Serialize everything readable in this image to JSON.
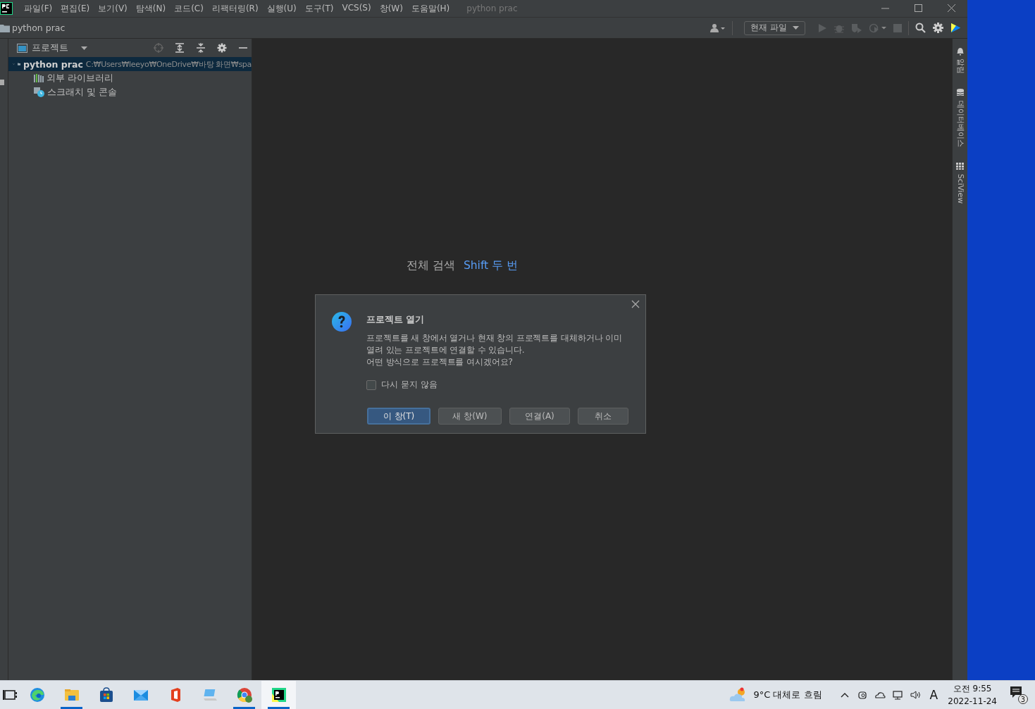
{
  "menu_bar": {
    "items": [
      "파일(F)",
      "편집(E)",
      "보기(V)",
      "탐색(N)",
      "코드(C)",
      "리팩터링(R)",
      "실행(U)",
      "도구(T)",
      "VCS(S)",
      "창(W)",
      "도움말(H)"
    ],
    "title": "python prac"
  },
  "nav_bar": {
    "breadcrumb": "python prac",
    "run_config": "현재 파일"
  },
  "project_panel": {
    "title": "프로젝트",
    "tree": [
      {
        "label": "python prac",
        "path": "C:₩Users₩leeyo₩OneDrive₩바탕 화면₩spa",
        "kind": "folder",
        "expanded": true,
        "selected": true,
        "children": [
          {
            "label": "외부 라이브러리",
            "kind": "library",
            "selected": false
          },
          {
            "label": "스크래치 및 콘솔",
            "kind": "scratch",
            "selected": false
          }
        ]
      }
    ]
  },
  "editor": {
    "hints": [
      {
        "action": "전체 검색",
        "shortcut": "Shift 두 번"
      }
    ]
  },
  "right_tool_windows": [
    {
      "label": "알림",
      "kind": "bell"
    },
    {
      "label": "데이터베이스",
      "kind": "database"
    },
    {
      "label": "SciView",
      "kind": "grid"
    }
  ],
  "dialog": {
    "title": "프로젝트 열기",
    "message_lines": [
      "프로젝트를 새 창에서 열거나 현재 창의 프로젝트를 대체하거나 이미",
      "열려 있는 프로젝트에 연결할 수 있습니다.",
      "어떤 방식으로 프로젝트를 여시겠어요?"
    ],
    "checkbox": {
      "label": "다시 묻지 않음",
      "checked": false
    },
    "buttons": [
      {
        "label": "이 창(T)",
        "default": true
      },
      {
        "label": "새 창(W)",
        "default": false
      },
      {
        "label": "연결(A)",
        "default": false
      },
      {
        "label": "취소",
        "default": false
      }
    ]
  },
  "taskbar": {
    "apps": [
      {
        "kind": "taskview",
        "running": false,
        "active": false
      },
      {
        "kind": "edge",
        "running": false,
        "active": false
      },
      {
        "kind": "explorer",
        "running": true,
        "active": false
      },
      {
        "kind": "store",
        "running": false,
        "active": false
      },
      {
        "kind": "mail",
        "running": false,
        "active": false
      },
      {
        "kind": "office",
        "running": false,
        "active": false
      },
      {
        "kind": "laptop",
        "running": false,
        "active": false
      },
      {
        "kind": "chrome",
        "running": true,
        "active": false
      },
      {
        "kind": "pycharm",
        "running": true,
        "active": true
      }
    ],
    "weather": "9°C 대체로 흐림",
    "input_mode": "A",
    "time": "오전 9:55",
    "date": "2022-11-24",
    "notifications": "3"
  }
}
